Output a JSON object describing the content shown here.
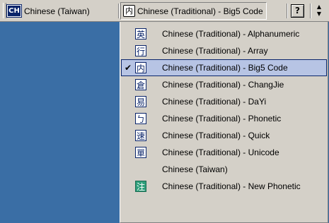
{
  "langbar": {
    "language_badge": "CH",
    "language_label": "Chinese (Taiwan)",
    "ime_icon_char": "内",
    "ime_label": "Chinese (Traditional) - Big5 Code",
    "help_label": "?",
    "options_glyph": "⋮"
  },
  "menu": {
    "items": [
      {
        "label": "Chinese (Traditional) - Alphanumeric",
        "icon": "英",
        "checked": false
      },
      {
        "label": "Chinese (Traditional) - Array",
        "icon": "行",
        "checked": false
      },
      {
        "label": "Chinese (Traditional) - Big5 Code",
        "icon": "内",
        "checked": true
      },
      {
        "label": "Chinese (Traditional) - ChangJie",
        "icon": "倉",
        "checked": false
      },
      {
        "label": "Chinese (Traditional) - DaYi",
        "icon": "易",
        "checked": false
      },
      {
        "label": "Chinese (Traditional) - Phonetic",
        "icon": "ㄅ",
        "checked": false
      },
      {
        "label": "Chinese (Traditional) - Quick",
        "icon": "速",
        "checked": false
      },
      {
        "label": "Chinese (Traditional) - Unicode",
        "icon": "單",
        "checked": false
      },
      {
        "label": "Chinese (Taiwan)",
        "icon": "",
        "checked": false
      },
      {
        "label": "Chinese (Traditional) - New Phonetic",
        "icon": "注",
        "checked": false
      }
    ],
    "check_mark": "✔"
  },
  "colors": {
    "desktop": "#3a6ea5",
    "bar_face": "#d4d0c8",
    "selection": "#b7c4e4",
    "badge": "#0a246a",
    "new_phonetic_icon": "#2e9e7a"
  }
}
